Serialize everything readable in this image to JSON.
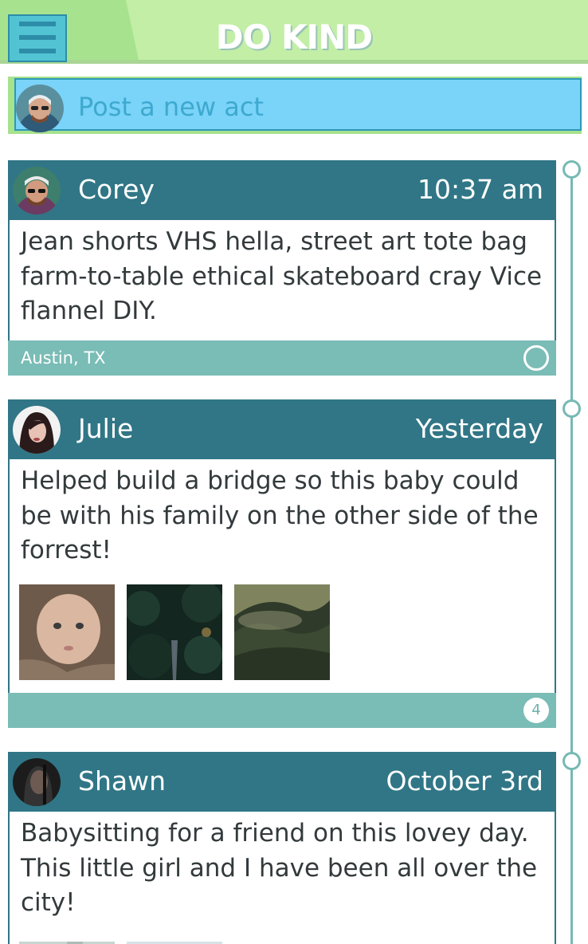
{
  "app": {
    "title": "DO KIND"
  },
  "post_bar": {
    "placeholder": "Post a new act"
  },
  "posts": [
    {
      "user": "Corey",
      "time": "10:37 am",
      "text": "Jean shorts VHS hella, street art tote bag farm-to-table ethical skateboard cray Vice flannel DIY.",
      "location": "Austin, TX",
      "footer_indicator": "empty-circle"
    },
    {
      "user": "Julie",
      "time": "Yesterday",
      "text": "Helped build a bridge so this baby could be with his family on the other side of the forrest!",
      "photos": [
        "baby-photo",
        "forest-path-photo",
        "misty-forest-photo"
      ],
      "count": "4"
    },
    {
      "user": "Shawn",
      "time": "October 3rd",
      "text": "Babysitting for a friend on this lovey day. This little girl and I have been all over the city!",
      "photos": [
        "city-photo",
        "sky-photo"
      ]
    }
  ],
  "colors": {
    "header_bg": "#c2eea6",
    "card_header": "#307686",
    "card_footer": "#7abcb6",
    "post_input": "#7ad3f8",
    "menu_button": "#52c3d3"
  },
  "icons": [
    "menu-icon",
    "timeline-dot-icon",
    "empty-circle-icon",
    "count-badge"
  ]
}
